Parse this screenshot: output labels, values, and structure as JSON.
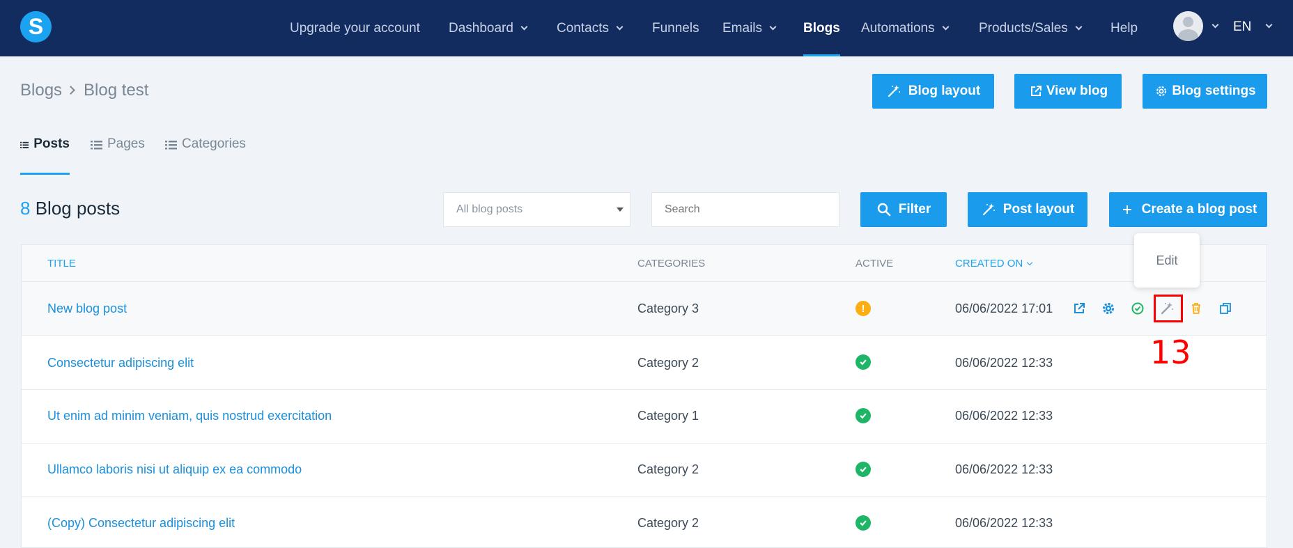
{
  "nav": {
    "logo": "S",
    "items": [
      {
        "label": "Upgrade your account",
        "dropdown": false,
        "active": false
      },
      {
        "label": "Dashboard",
        "dropdown": true,
        "active": false
      },
      {
        "label": "Contacts",
        "dropdown": true,
        "active": false
      },
      {
        "label": "Funnels",
        "dropdown": false,
        "active": false
      },
      {
        "label": "Emails",
        "dropdown": true,
        "active": false
      },
      {
        "label": "Blogs",
        "dropdown": false,
        "active": true
      },
      {
        "label": "Automations",
        "dropdown": true,
        "active": false
      },
      {
        "label": "Products/Sales",
        "dropdown": true,
        "active": false
      },
      {
        "label": "Help",
        "dropdown": false,
        "active": false
      }
    ],
    "language": "EN"
  },
  "breadcrumb": {
    "root": "Blogs",
    "current": "Blog test"
  },
  "header_buttons": {
    "blog_layout": "Blog layout",
    "view_blog": "View blog",
    "blog_settings": "Blog settings"
  },
  "tabs": [
    {
      "label": "Posts",
      "active": true
    },
    {
      "label": "Pages",
      "active": false
    },
    {
      "label": "Categories",
      "active": false
    }
  ],
  "toolbar": {
    "count": "8",
    "count_label": "Blog posts",
    "filter_select": "All blog posts",
    "search_placeholder": "Search",
    "filter_button": "Filter",
    "post_layout_button": "Post layout",
    "create_button": "Create a blog post"
  },
  "table": {
    "columns": {
      "title": "TITLE",
      "categories": "CATEGORIES",
      "active": "ACTIVE",
      "created_on": "CREATED ON"
    },
    "rows": [
      {
        "title": "New blog post",
        "category": "Category 3",
        "status": "warning",
        "created": "06/06/2022 17:01"
      },
      {
        "title": "Consectetur adipiscing elit",
        "category": "Category 2",
        "status": "active",
        "created": "06/06/2022 12:33"
      },
      {
        "title": "Ut enim ad minim veniam, quis nostrud exercitation",
        "category": "Category 1",
        "status": "active",
        "created": "06/06/2022 12:33"
      },
      {
        "title": "Ullamco laboris nisi ut aliquip ex ea commodo",
        "category": "Category 2",
        "status": "active",
        "created": "06/06/2022 12:33"
      },
      {
        "title": "(Copy) Consectetur adipiscing elit",
        "category": "Category 2",
        "status": "active",
        "created": "06/06/2022 12:33"
      }
    ],
    "row_actions": [
      "external-link-icon",
      "gear-icon",
      "check-circle-icon",
      "magic-wand-icon",
      "trash-icon",
      "copy-icon"
    ]
  },
  "tooltip": {
    "text": "Edit"
  },
  "annotation": {
    "label": "13"
  },
  "colors": {
    "nav_bg": "#132c5f",
    "accent": "#1ba2f0",
    "button": "#1a9bec",
    "success": "#1fb567",
    "warning": "#fcae13",
    "danger_highlight": "#ff0000"
  }
}
